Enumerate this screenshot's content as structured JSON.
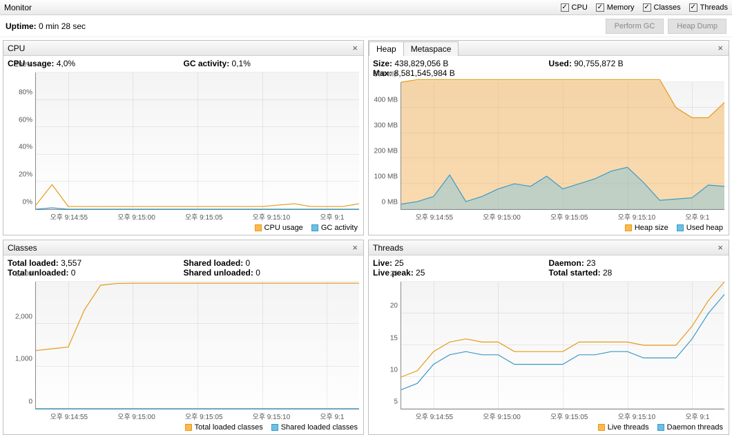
{
  "header": {
    "title": "Monitor",
    "checks": [
      "CPU",
      "Memory",
      "Classes",
      "Threads"
    ]
  },
  "uptime": {
    "label": "Uptime:",
    "value": "0 min 28 sec"
  },
  "buttons": {
    "perform_gc": "Perform GC",
    "heap_dump": "Heap Dump"
  },
  "panels": {
    "cpu": {
      "title": "CPU",
      "stats": {
        "cpu_usage_label": "CPU usage:",
        "cpu_usage_value": "4,0%",
        "gc_activity_label": "GC activity:",
        "gc_activity_value": "0,1%"
      },
      "legend": {
        "a": "CPU usage",
        "b": "GC activity"
      }
    },
    "heap": {
      "tabs": {
        "heap": "Heap",
        "metaspace": "Metaspace"
      },
      "stats": {
        "size_label": "Size:",
        "size_value": "438,829,056 B",
        "used_label": "Used:",
        "used_value": "90,755,872 B",
        "max_label": "Max:",
        "max_value": "8,581,545,984 B"
      },
      "legend": {
        "a": "Heap size",
        "b": "Used heap"
      }
    },
    "classes": {
      "title": "Classes",
      "stats": {
        "total_loaded_label": "Total loaded:",
        "total_loaded_value": "3,557",
        "shared_loaded_label": "Shared loaded:",
        "shared_loaded_value": "0",
        "total_unloaded_label": "Total unloaded:",
        "total_unloaded_value": "0",
        "shared_unloaded_label": "Shared unloaded:",
        "shared_unloaded_value": "0"
      },
      "legend": {
        "a": "Total loaded classes",
        "b": "Shared loaded classes"
      }
    },
    "threads": {
      "title": "Threads",
      "stats": {
        "live_label": "Live:",
        "live_value": "25",
        "daemon_label": "Daemon:",
        "daemon_value": "23",
        "live_peak_label": "Live peak:",
        "live_peak_value": "25",
        "total_started_label": "Total started:",
        "total_started_value": "28"
      },
      "legend": {
        "a": "Live threads",
        "b": "Daemon threads"
      }
    }
  },
  "x_ticks": [
    "오후 9:14:55",
    "오후 9:15:00",
    "오후 9:15:05",
    "오후 9:15:10",
    "오후 9:1"
  ],
  "chart_data": [
    {
      "type": "line",
      "title": "CPU",
      "ylabel": "%",
      "ylim": [
        0,
        100
      ],
      "y_ticks": [
        "0%",
        "20%",
        "40%",
        "60%",
        "80%",
        "100%"
      ],
      "x": [
        0,
        1,
        2,
        3,
        4,
        5,
        6,
        7,
        8,
        9,
        10,
        11,
        12,
        13,
        14,
        15,
        16,
        17,
        18,
        19,
        20
      ],
      "series": [
        {
          "name": "CPU usage",
          "color": "#e69a17",
          "values": [
            3,
            18,
            2,
            2,
            2,
            2,
            2,
            2,
            2,
            2,
            2,
            2,
            2,
            2,
            2,
            3,
            4,
            2,
            2,
            2,
            4
          ]
        },
        {
          "name": "GC activity",
          "color": "#3a9ac4",
          "values": [
            0,
            1,
            0,
            0,
            0,
            0,
            0,
            0,
            0,
            0,
            0,
            0,
            0,
            0,
            0,
            0,
            0,
            0,
            0,
            0,
            0
          ]
        }
      ]
    },
    {
      "type": "area",
      "title": "Heap",
      "ylabel": "MB",
      "ylim": [
        0,
        500
      ],
      "y_ticks": [
        "0 MB",
        "100 MB",
        "200 MB",
        "300 MB",
        "400 MB",
        "500 MB"
      ],
      "x": [
        0,
        1,
        2,
        3,
        4,
        5,
        6,
        7,
        8,
        9,
        10,
        11,
        12,
        13,
        14,
        15,
        16,
        17,
        18,
        19,
        20
      ],
      "series": [
        {
          "name": "Heap size",
          "color": "#e69a17",
          "fill": "rgba(244,176,80,0.45)",
          "values": [
            500,
            510,
            510,
            510,
            510,
            510,
            510,
            510,
            510,
            510,
            510,
            510,
            510,
            510,
            510,
            510,
            510,
            400,
            360,
            360,
            420
          ]
        },
        {
          "name": "Used heap",
          "color": "#3a9ac4",
          "fill": "rgba(108,192,229,0.4)",
          "values": [
            20,
            30,
            50,
            135,
            30,
            50,
            80,
            100,
            90,
            130,
            80,
            100,
            120,
            150,
            165,
            105,
            35,
            40,
            45,
            95,
            90
          ]
        }
      ]
    },
    {
      "type": "line",
      "title": "Classes",
      "ylabel": "",
      "ylim": [
        0,
        3600
      ],
      "y_ticks": [
        "0",
        "1,000",
        "2,000",
        "3,000"
      ],
      "x": [
        0,
        1,
        2,
        3,
        4,
        5,
        6,
        7,
        8,
        9,
        10,
        11,
        12,
        13,
        14,
        15,
        16,
        17,
        18,
        19,
        20
      ],
      "series": [
        {
          "name": "Total loaded classes",
          "color": "#e69a17",
          "values": [
            1650,
            1700,
            1750,
            2800,
            3500,
            3550,
            3557,
            3557,
            3557,
            3557,
            3557,
            3557,
            3557,
            3557,
            3557,
            3557,
            3557,
            3557,
            3557,
            3557,
            3557
          ]
        },
        {
          "name": "Shared loaded classes",
          "color": "#3a9ac4",
          "values": [
            0,
            0,
            0,
            0,
            0,
            0,
            0,
            0,
            0,
            0,
            0,
            0,
            0,
            0,
            0,
            0,
            0,
            0,
            0,
            0,
            0
          ]
        }
      ]
    },
    {
      "type": "line",
      "title": "Threads",
      "ylabel": "",
      "ylim": [
        5,
        25
      ],
      "y_ticks": [
        "5",
        "10",
        "15",
        "20",
        "25"
      ],
      "x": [
        0,
        1,
        2,
        3,
        4,
        5,
        6,
        7,
        8,
        9,
        10,
        11,
        12,
        13,
        14,
        15,
        16,
        17,
        18,
        19,
        20
      ],
      "series": [
        {
          "name": "Live threads",
          "color": "#e69a17",
          "values": [
            10,
            11,
            14,
            15.5,
            16,
            15.5,
            15.5,
            14,
            14,
            14,
            14,
            15.5,
            15.5,
            15.5,
            15.5,
            15,
            15,
            15,
            18,
            22,
            25
          ]
        },
        {
          "name": "Daemon threads",
          "color": "#3a9ac4",
          "values": [
            8,
            9,
            12,
            13.5,
            14,
            13.5,
            13.5,
            12,
            12,
            12,
            12,
            13.5,
            13.5,
            14,
            14,
            13,
            13,
            13,
            16,
            20,
            23
          ]
        }
      ]
    }
  ]
}
